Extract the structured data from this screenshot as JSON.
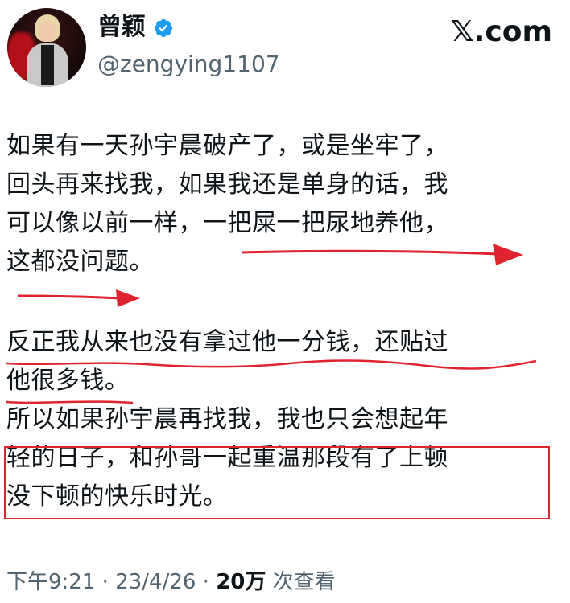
{
  "header": {
    "display_name": "曾颖",
    "handle": "@zengying1107",
    "brand": "𝕏.com",
    "verified_icon": "verified-badge-icon",
    "colors": {
      "verified": "#1d9bf0",
      "secondary_text": "#536471",
      "primary_text": "#0f1419"
    }
  },
  "tweet": {
    "lines": [
      "如果有一天孙宇晨破产了，或是坐牢了，",
      "回头再来找我，如果我还是单身的话，我",
      "可以像以前一样，一把屎一把尿地养他，",
      "这都没问题。",
      "反正我从来也没有拿过他一分钱，还贴过",
      "他很多钱。",
      "所以如果孙宇晨再找我，我也只会想起年",
      "轻的日子，和孙哥一起重温那段有了上顿",
      "没下顿的快乐时光。"
    ]
  },
  "meta": {
    "time": "下午9:21",
    "sep1": " · ",
    "date": "23/4/26",
    "sep2": " · ",
    "views_count": "20万",
    "views_label": " 次查看"
  },
  "annotations": {
    "color": "#e0242f"
  }
}
